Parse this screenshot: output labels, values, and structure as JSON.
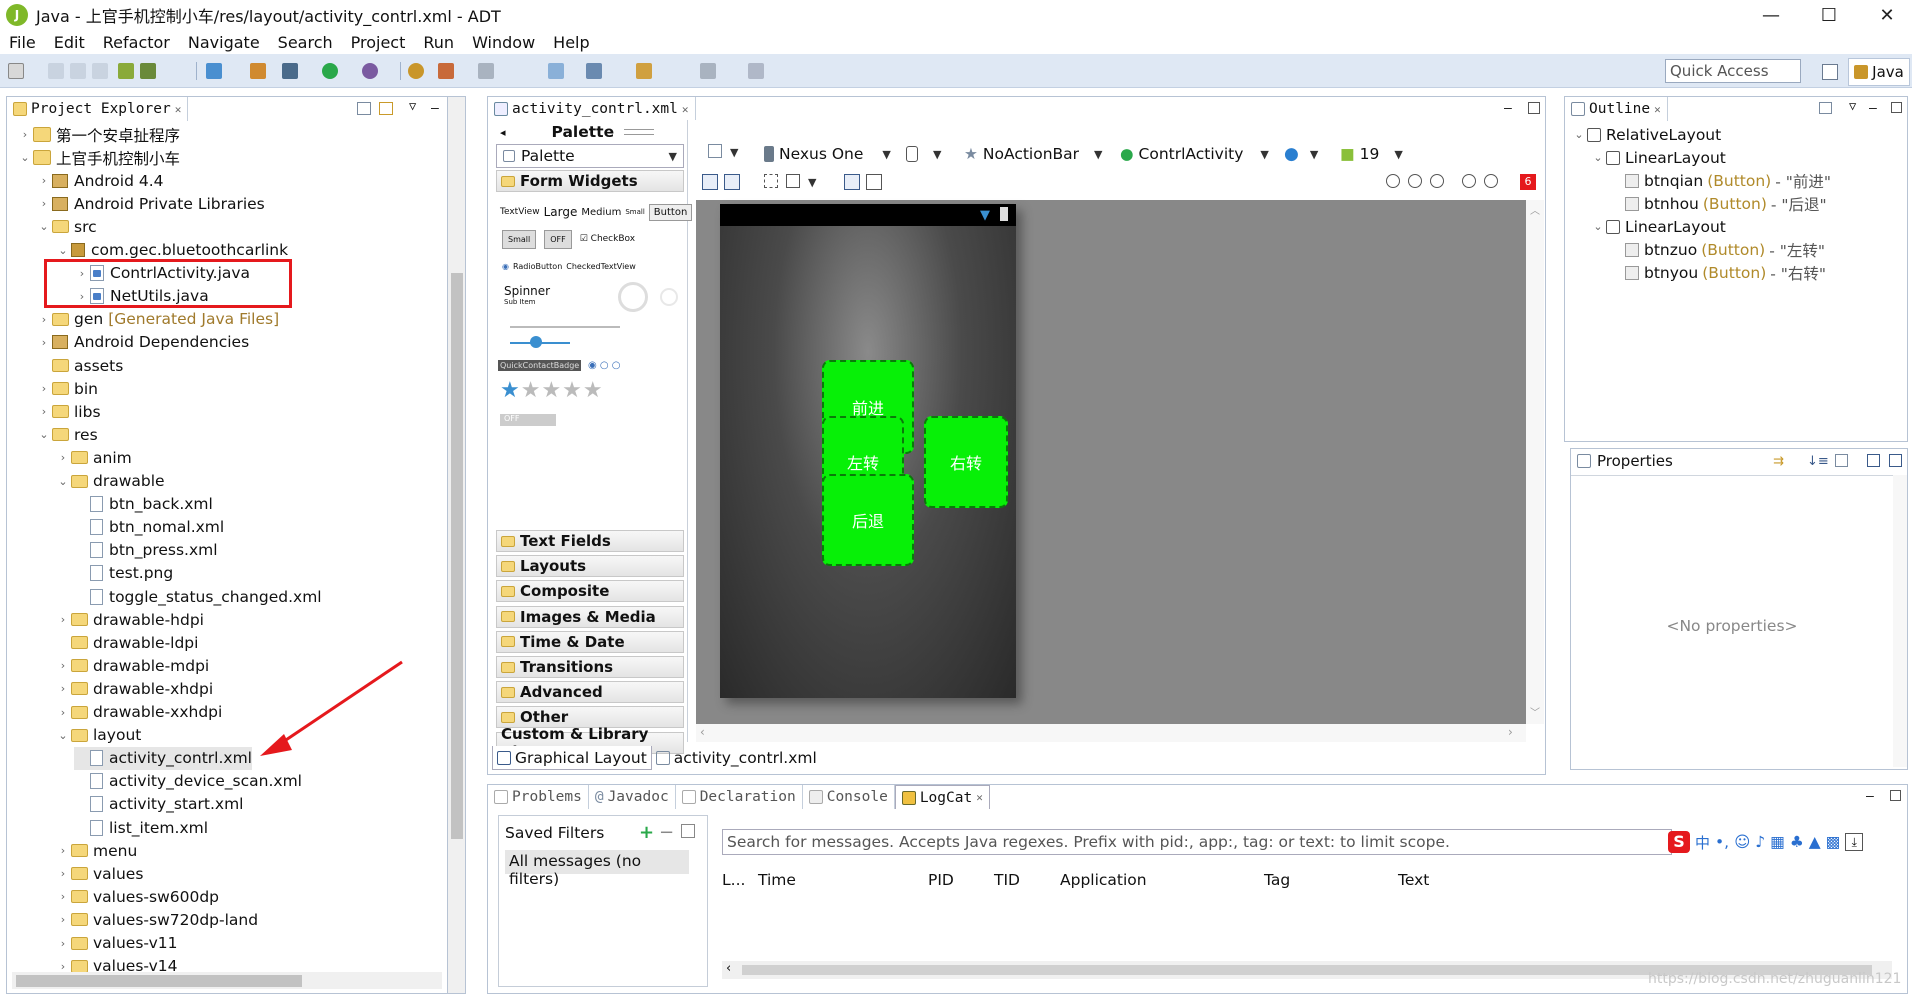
{
  "window": {
    "title": "Java - 上官手机控制小车/res/layout/activity_contrl.xml - ADT",
    "min": "—",
    "max": "☐",
    "close": "✕"
  },
  "menu": [
    "File",
    "Edit",
    "Refactor",
    "Navigate",
    "Search",
    "Project",
    "Run",
    "Window",
    "Help"
  ],
  "quick_access": {
    "placeholder": "Quick Access"
  },
  "perspective": {
    "label": "Java"
  },
  "project_explorer": {
    "tab": "Project Explorer",
    "items": [
      {
        "label": "第一个安卓扯程序",
        "indent": 1,
        "arrow": "›",
        "icon": "proj"
      },
      {
        "label": "上官手机控制小车",
        "indent": 1,
        "arrow": "⌄",
        "icon": "proj"
      },
      {
        "label": "Android 4.4",
        "indent": 2,
        "arrow": "›",
        "icon": "lib"
      },
      {
        "label": "Android Private Libraries",
        "indent": 2,
        "arrow": "›",
        "icon": "lib"
      },
      {
        "label": "src",
        "indent": 2,
        "arrow": "⌄",
        "icon": "fold"
      },
      {
        "label": "com.gec.bluetoothcarlink",
        "indent": 3,
        "arrow": "⌄",
        "icon": "pkg"
      },
      {
        "label": "ContrlActivity.java",
        "indent": 4,
        "arrow": "›",
        "icon": "jfile"
      },
      {
        "label": "NetUtils.java",
        "indent": 4,
        "arrow": "›",
        "icon": "jfile"
      },
      {
        "label": "gen",
        "suffix": "[Generated Java Files]",
        "indent": 2,
        "arrow": "›",
        "icon": "fold"
      },
      {
        "label": "Android Dependencies",
        "indent": 2,
        "arrow": "›",
        "icon": "lib"
      },
      {
        "label": "assets",
        "indent": 2,
        "arrow": "",
        "icon": "fold"
      },
      {
        "label": "bin",
        "indent": 2,
        "arrow": "›",
        "icon": "fold"
      },
      {
        "label": "libs",
        "indent": 2,
        "arrow": "›",
        "icon": "fold"
      },
      {
        "label": "res",
        "indent": 2,
        "arrow": "⌄",
        "icon": "fold"
      },
      {
        "label": "anim",
        "indent": 3,
        "arrow": "›",
        "icon": "fold"
      },
      {
        "label": "drawable",
        "indent": 3,
        "arrow": "⌄",
        "icon": "fold"
      },
      {
        "label": "btn_back.xml",
        "indent": 4,
        "arrow": "",
        "icon": "file"
      },
      {
        "label": "btn_nomal.xml",
        "indent": 4,
        "arrow": "",
        "icon": "file"
      },
      {
        "label": "btn_press.xml",
        "indent": 4,
        "arrow": "",
        "icon": "file"
      },
      {
        "label": "test.png",
        "indent": 4,
        "arrow": "",
        "icon": "file"
      },
      {
        "label": "toggle_status_changed.xml",
        "indent": 4,
        "arrow": "",
        "icon": "file"
      },
      {
        "label": "drawable-hdpi",
        "indent": 3,
        "arrow": "›",
        "icon": "fold"
      },
      {
        "label": "drawable-ldpi",
        "indent": 3,
        "arrow": "",
        "icon": "fold"
      },
      {
        "label": "drawable-mdpi",
        "indent": 3,
        "arrow": "›",
        "icon": "fold"
      },
      {
        "label": "drawable-xhdpi",
        "indent": 3,
        "arrow": "›",
        "icon": "fold"
      },
      {
        "label": "drawable-xxhdpi",
        "indent": 3,
        "arrow": "›",
        "icon": "fold"
      },
      {
        "label": "layout",
        "indent": 3,
        "arrow": "⌄",
        "icon": "fold"
      },
      {
        "label": "activity_contrl.xml",
        "indent": 4,
        "arrow": "",
        "icon": "file",
        "selected": true
      },
      {
        "label": "activity_device_scan.xml",
        "indent": 4,
        "arrow": "",
        "icon": "file"
      },
      {
        "label": "activity_start.xml",
        "indent": 4,
        "arrow": "",
        "icon": "file"
      },
      {
        "label": "list_item.xml",
        "indent": 4,
        "arrow": "",
        "icon": "file"
      },
      {
        "label": "menu",
        "indent": 3,
        "arrow": "›",
        "icon": "fold"
      },
      {
        "label": "values",
        "indent": 3,
        "arrow": "›",
        "icon": "fold"
      },
      {
        "label": "values-sw600dp",
        "indent": 3,
        "arrow": "›",
        "icon": "fold"
      },
      {
        "label": "values-sw720dp-land",
        "indent": 3,
        "arrow": "›",
        "icon": "fold"
      },
      {
        "label": "values-v11",
        "indent": 3,
        "arrow": "›",
        "icon": "fold"
      },
      {
        "label": "values-v14",
        "indent": 3,
        "arrow": "›",
        "icon": "fold"
      }
    ]
  },
  "editor": {
    "tab": "activity_contrl.xml",
    "palette_title": "Palette",
    "palette_dropdown": "Palette",
    "form_widgets": "Form Widgets",
    "widget_textview": "TextView",
    "widget_large": "Large",
    "widget_medium": "Medium",
    "widget_small": "Small",
    "widget_button": "Button",
    "widget_smallbtn": "Small",
    "widget_off": "OFF",
    "widget_checkbox": "CheckBox",
    "widget_radio": "RadioButton",
    "widget_checkedtv": "CheckedTextView",
    "widget_spinner": "Spinner",
    "widget_subitem": "Sub Item",
    "widget_badge": "QuickContactBadge",
    "widget_switch_off": "OFF",
    "sections": [
      "Text Fields",
      "Layouts",
      "Composite",
      "Images & Media",
      "Time & Date",
      "Transitions",
      "Advanced",
      "Other",
      "Custom & Library Views"
    ],
    "device": "Nexus One",
    "theme": "NoActionBar",
    "activity": "ContrlActivity",
    "api": "19",
    "error_count": "6",
    "buttons": {
      "forward": "前进",
      "left": "左转",
      "right": "右转",
      "back": "后退"
    },
    "bottom_tabs": [
      "Graphical Layout",
      "activity_contrl.xml"
    ]
  },
  "outline": {
    "tab": "Outline",
    "items": [
      {
        "label": "RelativeLayout",
        "indent": 0,
        "arrow": "⌄"
      },
      {
        "label": "LinearLayout",
        "indent": 1,
        "arrow": "⌄"
      },
      {
        "label": "btnqian",
        "type": "(Button)",
        "text": "- \"前进\"",
        "indent": 2,
        "arrow": ""
      },
      {
        "label": "btnhou",
        "type": "(Button)",
        "text": "- \"后退\"",
        "indent": 2,
        "arrow": ""
      },
      {
        "label": "LinearLayout",
        "indent": 1,
        "arrow": "⌄"
      },
      {
        "label": "btnzuo",
        "type": "(Button)",
        "text": "- \"左转\"",
        "indent": 2,
        "arrow": ""
      },
      {
        "label": "btnyou",
        "type": "(Button)",
        "text": "- \"右转\"",
        "indent": 2,
        "arrow": ""
      }
    ]
  },
  "properties": {
    "tab": "Properties",
    "empty": "<No properties>"
  },
  "bottom": {
    "tabs": [
      "Problems",
      "Javadoc",
      "Declaration",
      "Console",
      "LogCat"
    ],
    "saved_filters": "Saved Filters",
    "all_messages": "All messages (no filters)",
    "search_placeholder": "Search for messages. Accepts Java regexes. Prefix with pid:, app:, tag: or text: to limit scope.",
    "columns": [
      "L...",
      "Time",
      "PID",
      "TID",
      "Application",
      "Tag",
      "Text"
    ],
    "ime_label": "中"
  },
  "watermark": "https://blog.csdn.net/zhuguanlin121",
  "colors": {
    "accent_red": "#e5191d",
    "button_green": "#07f007"
  }
}
